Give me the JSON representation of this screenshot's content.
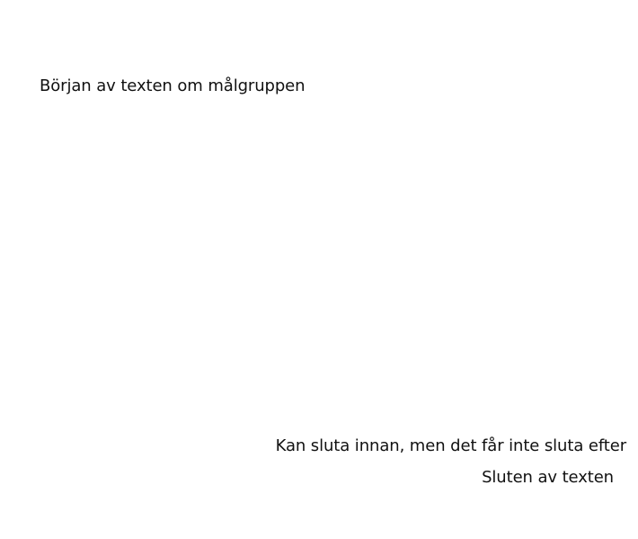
{
  "content": {
    "start_text": "Början av texten om målgruppen",
    "middle_note": "Kan sluta innan, men det får inte sluta efter",
    "end_text": "Sluten av texten"
  }
}
